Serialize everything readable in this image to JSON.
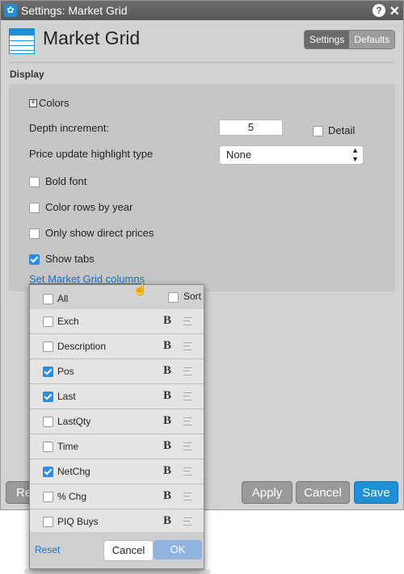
{
  "window": {
    "title": "Settings: Market Grid"
  },
  "header": {
    "title": "Market Grid",
    "tabs": [
      {
        "label": "Settings",
        "active": true
      },
      {
        "label": "Defaults",
        "active": false
      }
    ]
  },
  "section": {
    "title": "Display"
  },
  "display": {
    "colors_label": "Colors",
    "depth_label": "Depth increment:",
    "depth_value": "5",
    "detail_label": "Detail",
    "detail_checked": false,
    "highlight_label": "Price update highlight type",
    "highlight_value": "None",
    "options": [
      {
        "label": "Bold font",
        "checked": false
      },
      {
        "label": "Color rows by year",
        "checked": false
      },
      {
        "label": "Only show direct prices",
        "checked": false
      },
      {
        "label": "Show tabs",
        "checked": true
      }
    ],
    "columns_link": "Set Market Grid columns"
  },
  "popup": {
    "all_label": "All",
    "sort_label": "Sort",
    "columns": [
      {
        "name": "Exch",
        "checked": false
      },
      {
        "name": "Description",
        "checked": false
      },
      {
        "name": "Pos",
        "checked": true
      },
      {
        "name": "Last",
        "checked": true
      },
      {
        "name": "LastQty",
        "checked": false
      },
      {
        "name": "Time",
        "checked": false
      },
      {
        "name": "NetChg",
        "checked": true
      },
      {
        "name": "% Chg",
        "checked": false
      },
      {
        "name": "PIQ Buys",
        "checked": false
      }
    ],
    "bold_glyph": "B",
    "reset_label": "Reset",
    "cancel_label": "Cancel",
    "ok_label": "OK"
  },
  "footer": {
    "reset_partial": "Re",
    "apply_label": "Apply",
    "cancel_label": "Cancel",
    "save_label": "Save"
  },
  "colors": {
    "accent": "#1f8fd6",
    "link": "#1f6fc4",
    "panel": "#c6c6c6"
  }
}
